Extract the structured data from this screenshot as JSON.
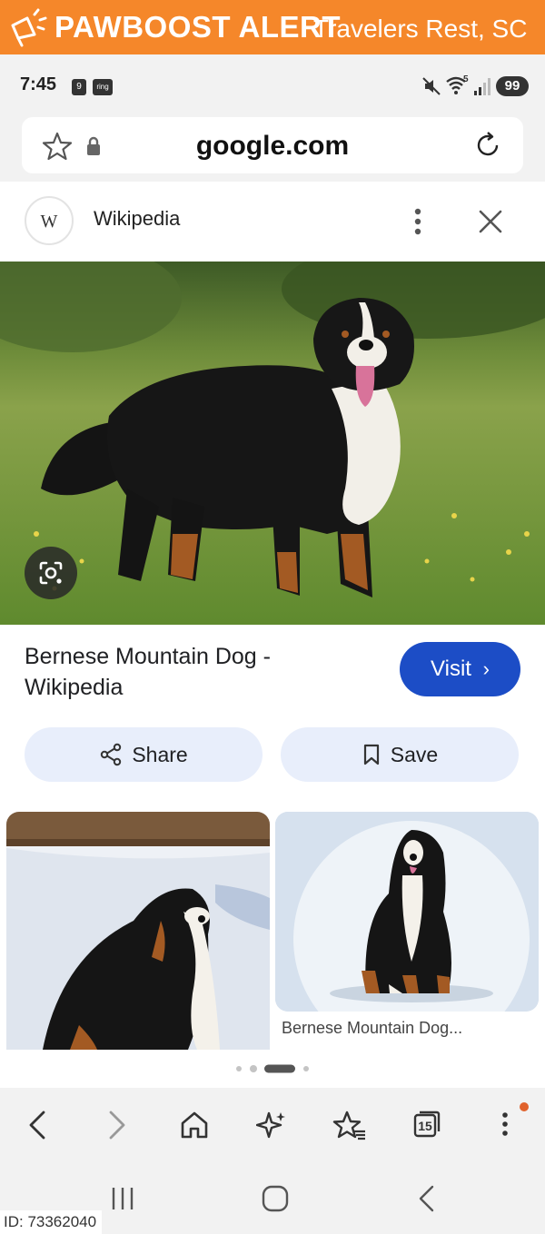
{
  "alert": {
    "brand": "PAWBOOST ALERT",
    "location": "Travelers Rest, SC",
    "color": "#f5872a"
  },
  "status": {
    "time": "7:45",
    "badge1": "9",
    "badge2": "ring",
    "network": "5",
    "battery": "99"
  },
  "browser": {
    "url": "google.com"
  },
  "source": {
    "logo_letter": "W",
    "name": "Wikipedia"
  },
  "result": {
    "title": "Bernese Mountain Dog - Wikipedia",
    "visit_label": "Visit",
    "visit_color": "#1c4dc6"
  },
  "actions": {
    "share_label": "Share",
    "save_label": "Save"
  },
  "related": {
    "second_caption": "Bernese Mountain Dog..."
  },
  "toolbar": {
    "tabs_count": "15"
  },
  "footer": {
    "id_text": "ID: 73362040"
  }
}
